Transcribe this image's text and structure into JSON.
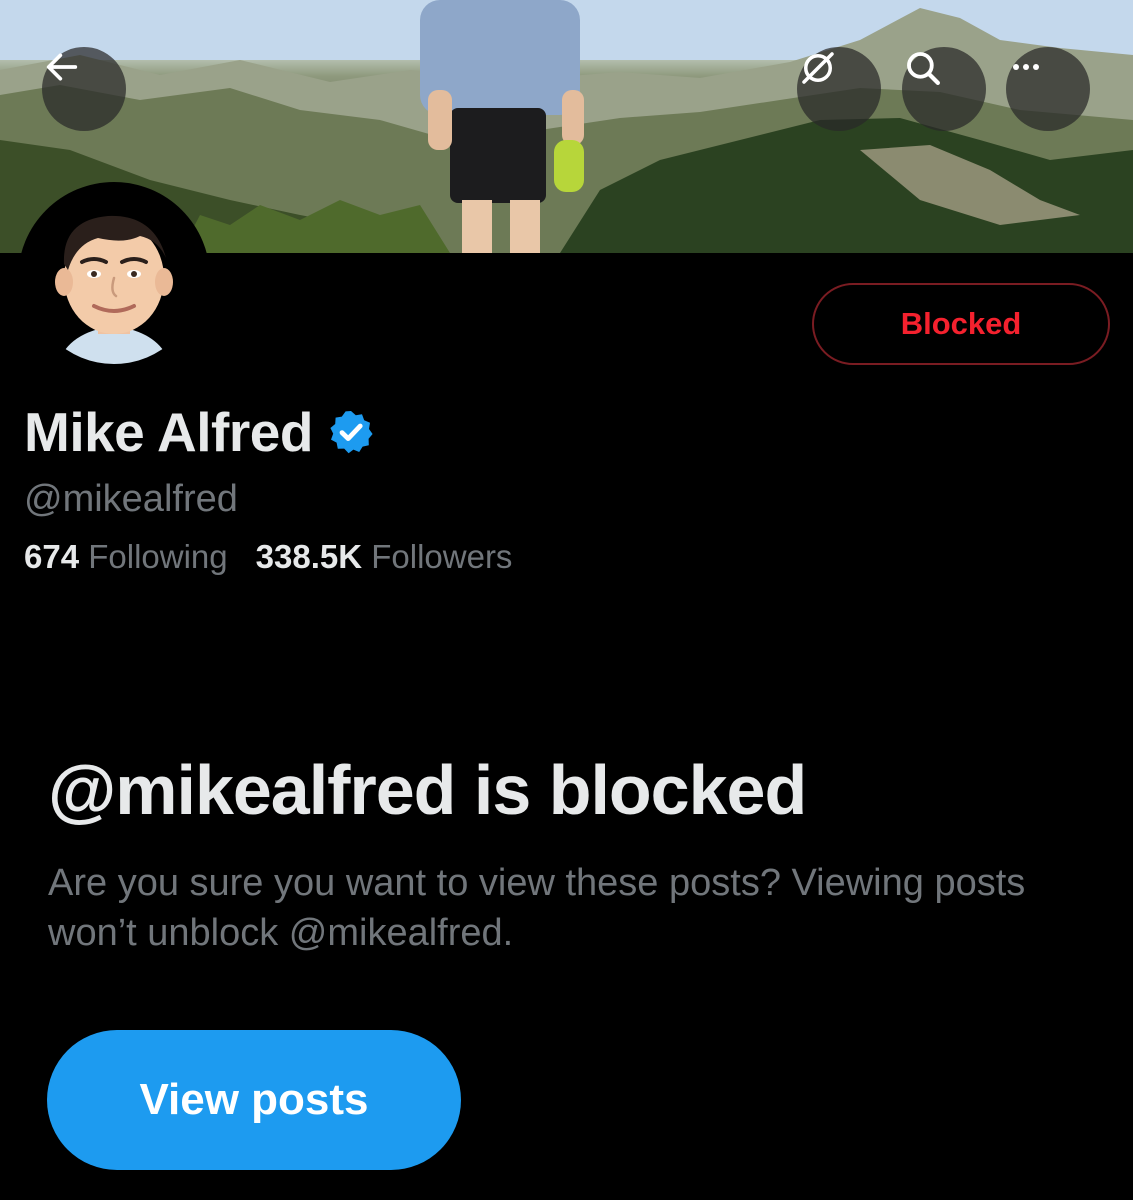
{
  "profile": {
    "display_name": "Mike Alfred",
    "handle": "@mikealfred",
    "following_count": "674",
    "following_label": "Following",
    "followers_count": "338.5K",
    "followers_label": "Followers",
    "verified": true
  },
  "header": {
    "blocked_button_label": "Blocked",
    "icons": [
      "back-arrow-icon",
      "grok-icon",
      "search-icon",
      "more-icon"
    ]
  },
  "blocked_notice": {
    "title": "@mikealfred is blocked",
    "description": "Are you sure you want to view these posts? Viewing posts won’t unblock @mikealfred.",
    "button_label": "View posts"
  },
  "colors": {
    "background": "#000000",
    "accent_blue": "#1d9bf0",
    "blocked_red": "#f4212e",
    "text_primary": "#e7e9ea",
    "text_secondary": "#71767b"
  }
}
